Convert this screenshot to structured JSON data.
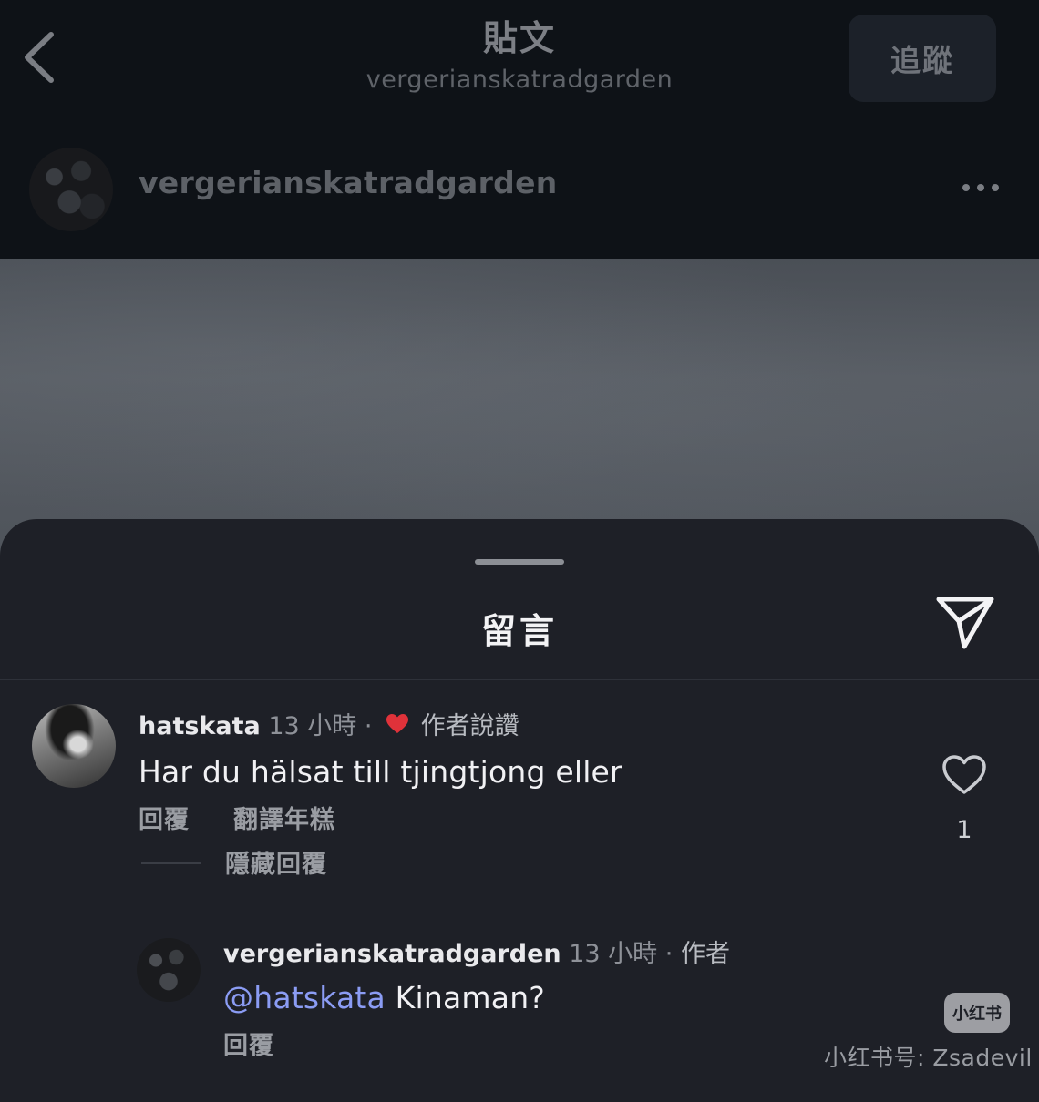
{
  "header": {
    "title": "貼文",
    "subtitle": "vergerianskatradgarden",
    "follow_label": "追蹤"
  },
  "author": {
    "username": "vergerianskatradgarden"
  },
  "comments_sheet": {
    "title": "留言",
    "comments": [
      {
        "username": "hatskata",
        "time": "13 小時",
        "separator": "·",
        "liked_by_author": "作者說讚",
        "text": "Har du hälsat till tjingtjong eller",
        "reply_label": "回覆",
        "translate_label": "翻譯年糕",
        "hide_replies_label": "隱藏回覆",
        "like_count": "1"
      }
    ],
    "replies": [
      {
        "username": "vergerianskatradgarden",
        "time": "13 小時",
        "separator": "·",
        "author_badge": "作者",
        "mention": "@hatskata",
        "text": " Kinaman?",
        "reply_label": "回覆"
      }
    ]
  },
  "watermark": {
    "logo_text": "小红书",
    "text": "小红书号: Zsadevil"
  },
  "colors": {
    "heart_red": "#e0323a",
    "mention_blue": "#8b9cf4",
    "sheet_bg": "#1e2027",
    "header_bg": "#0e1217"
  },
  "icons": {
    "back": "chevron-left-icon",
    "more": "more-horizontal-icon",
    "share": "send-icon",
    "like": "heart-outline-icon",
    "liked_by_author": "heart-filled-icon"
  }
}
